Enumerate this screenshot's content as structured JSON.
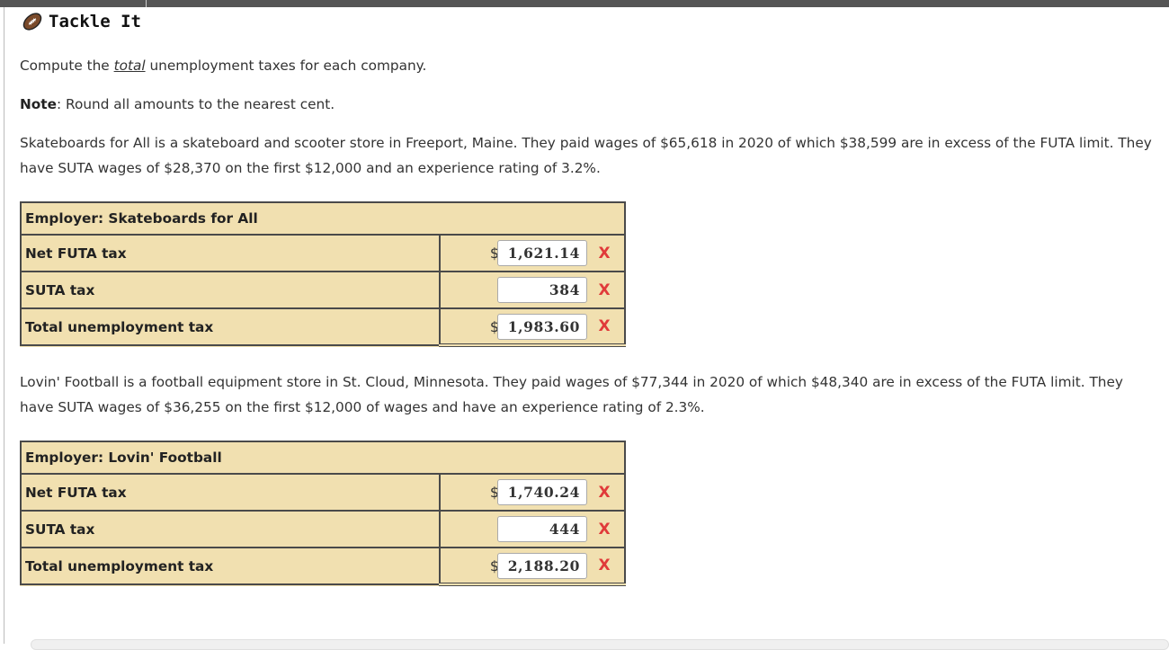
{
  "page": {
    "title": "Tackle It",
    "icon": "football-icon"
  },
  "instructions": {
    "prefix": "Compute the ",
    "emphasis": "total",
    "suffix": " unemployment taxes for each company.",
    "note_label": "Note",
    "note_text": ": Round all amounts to the nearest cent."
  },
  "problem1": {
    "description": "Skateboards for All is a skateboard and scooter store in Freeport, Maine. They paid wages of $65,618 in 2020 of which $38,599 are in excess of the FUTA limit. They have SUTA wages of $28,370 on the first $12,000 and an experience rating of 3.2%.",
    "table": {
      "header": "Employer: Skateboards for All",
      "rows": [
        {
          "label": "Net FUTA tax",
          "currency": "$",
          "value": "1,621.14",
          "status": "X"
        },
        {
          "label": "SUTA tax",
          "currency": "",
          "value": "384",
          "status": "X"
        },
        {
          "label": "Total unemployment tax",
          "currency": "$",
          "value": "1,983.60",
          "status": "X"
        }
      ]
    }
  },
  "problem2": {
    "description": "Lovin' Football is a football equipment store in St. Cloud, Minnesota. They paid wages of $77,344 in 2020 of which $48,340 are in excess of the FUTA limit. They have SUTA wages of $36,255 on the first $12,000 of wages and have an experience rating of 2.3%.",
    "table": {
      "header": "Employer: Lovin' Football",
      "rows": [
        {
          "label": "Net FUTA tax",
          "currency": "$",
          "value": "1,740.24",
          "status": "X"
        },
        {
          "label": "SUTA tax",
          "currency": "",
          "value": "444",
          "status": "X"
        },
        {
          "label": "Total unemployment tax",
          "currency": "$",
          "value": "2,188.20",
          "status": "X"
        }
      ]
    }
  },
  "colors": {
    "table_bg": "#f1e0b0",
    "incorrect_mark": "#e03a3a",
    "border": "#4a4a4a"
  }
}
